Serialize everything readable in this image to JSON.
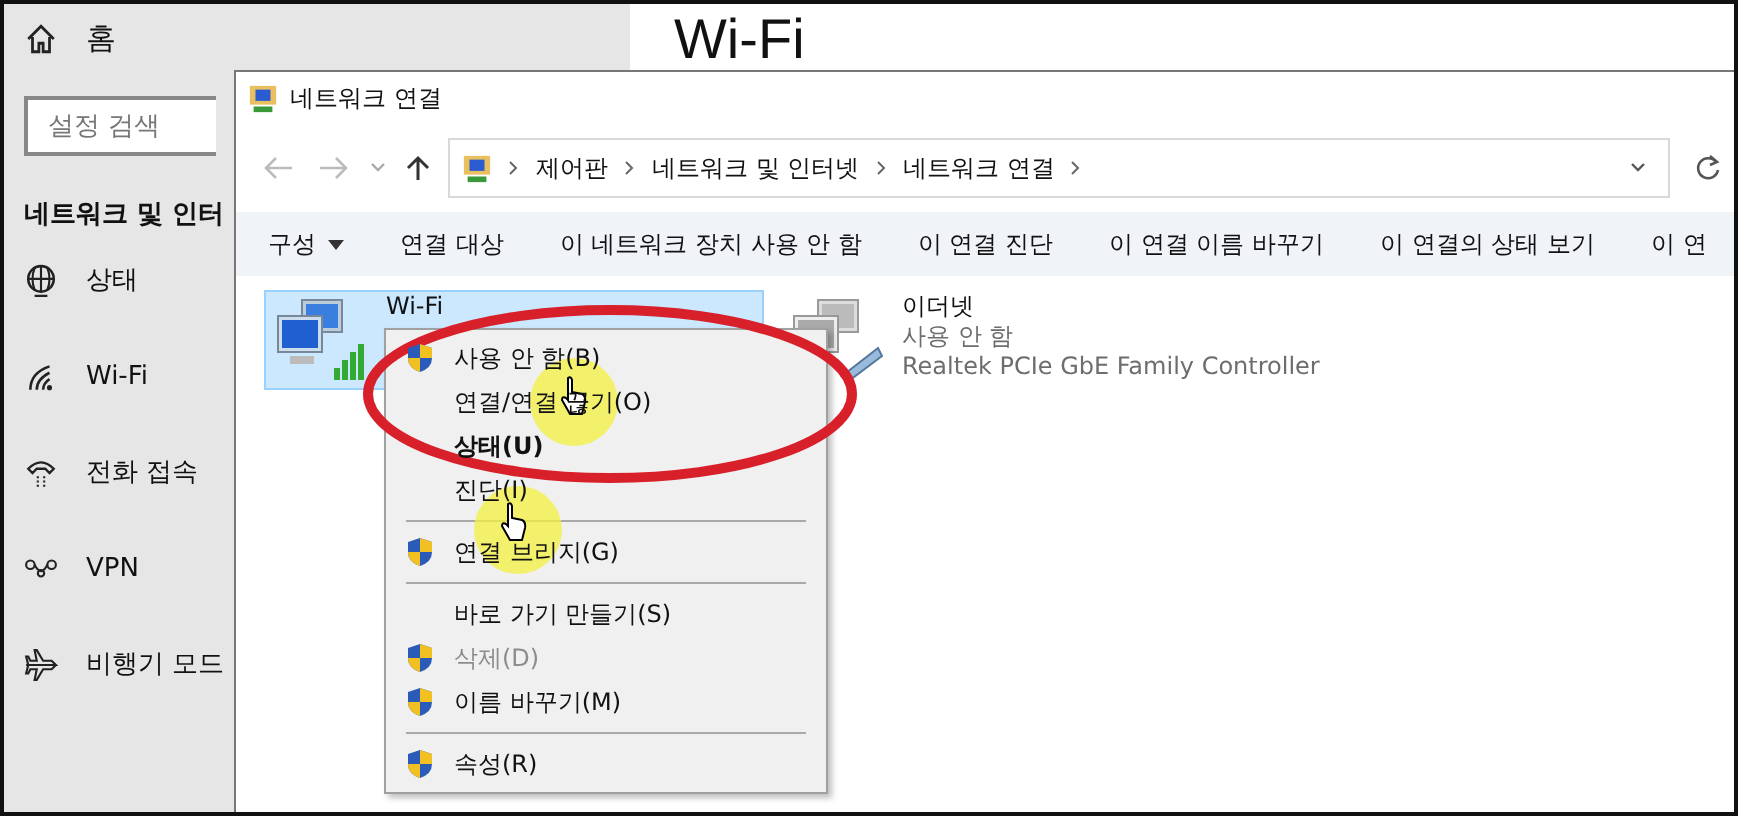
{
  "settings": {
    "home": "홈",
    "search": {
      "placeholder": "설정 검색"
    },
    "section_heading": "네트워크 및 인터",
    "nav": [
      {
        "label": "상태"
      },
      {
        "label": "Wi-Fi"
      },
      {
        "label": "전화 접속"
      },
      {
        "label": "VPN"
      },
      {
        "label": "비행기 모드"
      }
    ],
    "page_title": "Wi-Fi"
  },
  "window": {
    "title": "네트워크 연결",
    "breadcrumbs": [
      "제어판",
      "네트워크 및 인터넷",
      "네트워크 연결"
    ],
    "toolbar": [
      {
        "label": "구성",
        "dropdown": true
      },
      {
        "label": "연결 대상",
        "dropdown": false
      },
      {
        "label": "이 네트워크 장치 사용 안 함",
        "dropdown": false
      },
      {
        "label": "이 연결 진단",
        "dropdown": false
      },
      {
        "label": "이 연결 이름 바꾸기",
        "dropdown": false
      },
      {
        "label": "이 연결의 상태 보기",
        "dropdown": false
      },
      {
        "label": "이 연",
        "dropdown": false
      }
    ],
    "connections": [
      {
        "kind": "wifi",
        "name": "Wi-Fi",
        "selected": true
      },
      {
        "kind": "ethernet",
        "name": "이더넷",
        "selected": false,
        "lines": [
          "사용 안 함",
          "Realtek PCIe GbE Family Controller"
        ]
      }
    ]
  },
  "context_menu": [
    {
      "kind": "item",
      "label": "사용 안 함(B)",
      "shield": true,
      "bold": false,
      "disabled": false
    },
    {
      "kind": "item",
      "label": "연결/연결 끊기(O)",
      "shield": false,
      "bold": false,
      "disabled": false
    },
    {
      "kind": "item",
      "label": "상태(U)",
      "shield": false,
      "bold": true,
      "disabled": false
    },
    {
      "kind": "item",
      "label": "진단(I)",
      "shield": false,
      "bold": false,
      "disabled": false
    },
    {
      "kind": "separator"
    },
    {
      "kind": "item",
      "label": "연결 브리지(G)",
      "shield": true,
      "bold": false,
      "disabled": false
    },
    {
      "kind": "separator"
    },
    {
      "kind": "item",
      "label": "바로 가기 만들기(S)",
      "shield": false,
      "bold": false,
      "disabled": false
    },
    {
      "kind": "item",
      "label": "삭제(D)",
      "shield": true,
      "bold": false,
      "disabled": true
    },
    {
      "kind": "item",
      "label": "이름 바꾸기(M)",
      "shield": true,
      "bold": false,
      "disabled": false
    },
    {
      "kind": "separator"
    },
    {
      "kind": "item",
      "label": "속성(R)",
      "shield": true,
      "bold": false,
      "disabled": false
    }
  ]
}
